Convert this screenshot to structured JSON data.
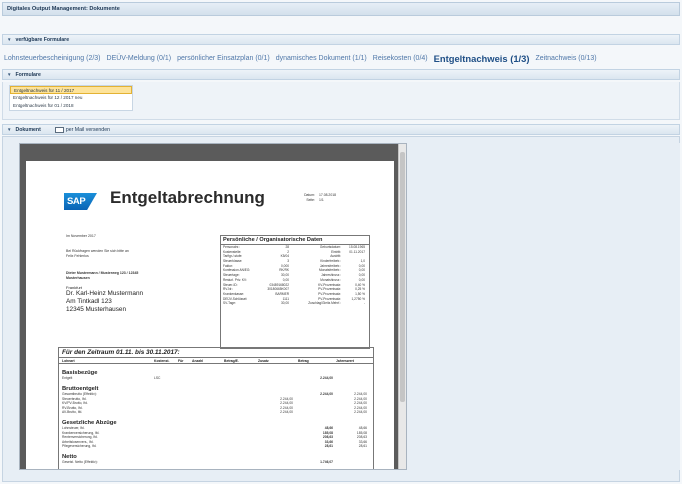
{
  "app": {
    "title": "Digitales Output Management: Dokumente"
  },
  "sections": {
    "available_forms": "verfügbare Formulare",
    "forms": "Formulare",
    "document": "Dokument",
    "send_mail": "per Mail versenden"
  },
  "form_tabs": [
    {
      "label": "Lohnsteuerbescheinigung (2/3)"
    },
    {
      "label": "DEÜV-Meldung (0/1)"
    },
    {
      "label": "persönlicher Einsatzplan (0/1)"
    },
    {
      "label": "dynamisches Dokument (1/1)"
    },
    {
      "label": "Reisekosten (0/4)"
    },
    {
      "label": "Entgeltnachweis (1/3)",
      "active": true
    },
    {
      "label": "Zeitnachweis (0/13)"
    }
  ],
  "form_list": [
    {
      "label": "Entgeltnachweis für 11 / 2017",
      "selected": true
    },
    {
      "label": "Entgeltnachweis für 12 / 2017 neu"
    },
    {
      "label": "Entgeltnachweis für 01 / 2018"
    }
  ],
  "document": {
    "logo": "SAP",
    "title": "Entgeltabrechnung",
    "meta": [
      {
        "label": "Datum:",
        "value": "17.08.2018"
      },
      {
        "label": "Seite:",
        "value": "1/1"
      }
    ],
    "month": "Im November 2017",
    "note_lines": [
      "Bei Rückfragen wenden Sie sich bitte an",
      "Felix Fehlerlos"
    ],
    "sender": [
      "Dieter Mustermann / Musterweg 123 / 12345",
      "Musterhausen",
      "Frankfurt"
    ],
    "address": [
      "Dr. Karl-Heinz Mustermann",
      "Am Tintkadl 123",
      "12345 Musterhausen"
    ],
    "personal_title": "Persönliche / Organisatorische Daten",
    "personal_rows": [
      {
        "a": "Personalnr.:",
        "b": "28",
        "c": "Geburtsdatum:",
        "d": "15.08.1965"
      },
      {
        "a": "Kostenstelle:",
        "b": "2",
        "c": "Eintritt:",
        "d": "01.11.2017"
      },
      {
        "a": "Tarifgr./-stufe:",
        "b": "K5/04",
        "c": "Austritt:",
        "d": ""
      },
      {
        "a": "Steuerklasse:",
        "b": "3",
        "c": "Kinderfreibetr.:",
        "d": "1,0"
      },
      {
        "a": "Faktor:",
        "b": "0,000",
        "c": "Jahresfreibetr.:",
        "d": "0,00"
      },
      {
        "a": "Konfession AN/EG:",
        "b": "RK/RK",
        "c": "Monatsfreibetr.:",
        "d": "0,00"
      },
      {
        "a": "Steuertage:",
        "b": "30,00",
        "c": "Jahreshinzur.:",
        "d": "0,00"
      },
      {
        "a": "Resturl. Priv. KV:",
        "b": "0,00",
        "c": "Monatshinzur.:",
        "d": "0,00"
      },
      {
        "a": "Steuer-ID:",
        "b": "03489168022",
        "c": "KV-Prozentsatz:",
        "d": "0,40 %"
      },
      {
        "a": "RV-Nr.:",
        "b": "30180665K007",
        "c": "PV-Prozentsatz:",
        "d": "0,25 %"
      },
      {
        "a": "Krankenkasse:",
        "b": "BARMER",
        "c": "PV-Prozentsatz:",
        "d": "1,50 %"
      },
      {
        "a": "DEÜV-Schlüssel:",
        "b": "1111",
        "c": "PV-Prozentsatz:",
        "d": "1,2750 %"
      },
      {
        "a": "SV-Tage:",
        "b": "30,00",
        "c": "Zuschlag/Gleitz.Mehrf.:",
        "d": "-"
      }
    ],
    "period_title": "Für den Zeitraum 01.11. bis 30.11.2017:",
    "columns": [
      "Lohnart",
      "Kostenst.",
      "Für",
      "Anzahl",
      "Betrag/E.",
      "Zusatz",
      "Betrag",
      "Jahreswert"
    ],
    "groups": [
      {
        "title": "Basisbezüge",
        "lines": [
          {
            "label": "Entgelt",
            "kst": "LSC",
            "zusatz": "",
            "betrag": "2.244,00",
            "jahr": ""
          }
        ]
      },
      {
        "title": "Bruttoentgelt",
        "lines": [
          {
            "label": "Gesamtbrutto (Effektiv):",
            "kst": "",
            "zusatz": "",
            "betrag": "2.244,00",
            "jahr": "2.244,00"
          },
          {
            "label": "Steuerbrutto, Ifd.",
            "kst": "",
            "zusatz": "2.244,00",
            "betrag": "",
            "jahr": "2.244,00"
          },
          {
            "label": "KV/PV-Brutto, Ifd.",
            "kst": "",
            "zusatz": "2.244,00",
            "betrag": "",
            "jahr": "2.244,00"
          },
          {
            "label": "RV-Brutto, Ifd.",
            "kst": "",
            "zusatz": "2.244,00",
            "betrag": "",
            "jahr": "2.244,00"
          },
          {
            "label": "AV-Brutto, Ifd.",
            "kst": "",
            "zusatz": "2.244,00",
            "betrag": "",
            "jahr": "2.244,00"
          }
        ]
      },
      {
        "title": "Gesetzliche Abzüge",
        "lines": [
          {
            "label": "Lohnsteuer, lfd.",
            "kst": "",
            "zusatz": "",
            "betrag": "48,66",
            "jahr": "48,66"
          },
          {
            "label": "Krankenversicherung, lfd.",
            "kst": "",
            "zusatz": "",
            "betrag": "185,08",
            "jahr": "185,08"
          },
          {
            "label": "Rentenversicherung, lfd.",
            "kst": "",
            "zusatz": "",
            "betrag": "208,63",
            "jahr": "208,63"
          },
          {
            "label": "Arbeitslosenvers., lfd.",
            "kst": "",
            "zusatz": "",
            "betrag": "33,66",
            "jahr": "33,66"
          },
          {
            "label": "Pflegeversicherung, lfd.",
            "kst": "",
            "zusatz": "",
            "betrag": "28,61",
            "jahr": "28,61"
          }
        ]
      },
      {
        "title": "Netto",
        "lines": [
          {
            "label": "Gesetzl. Netto (Effektiv):",
            "kst": "",
            "zusatz": "",
            "betrag": "1.746,07",
            "jahr": ""
          }
        ]
      }
    ]
  }
}
